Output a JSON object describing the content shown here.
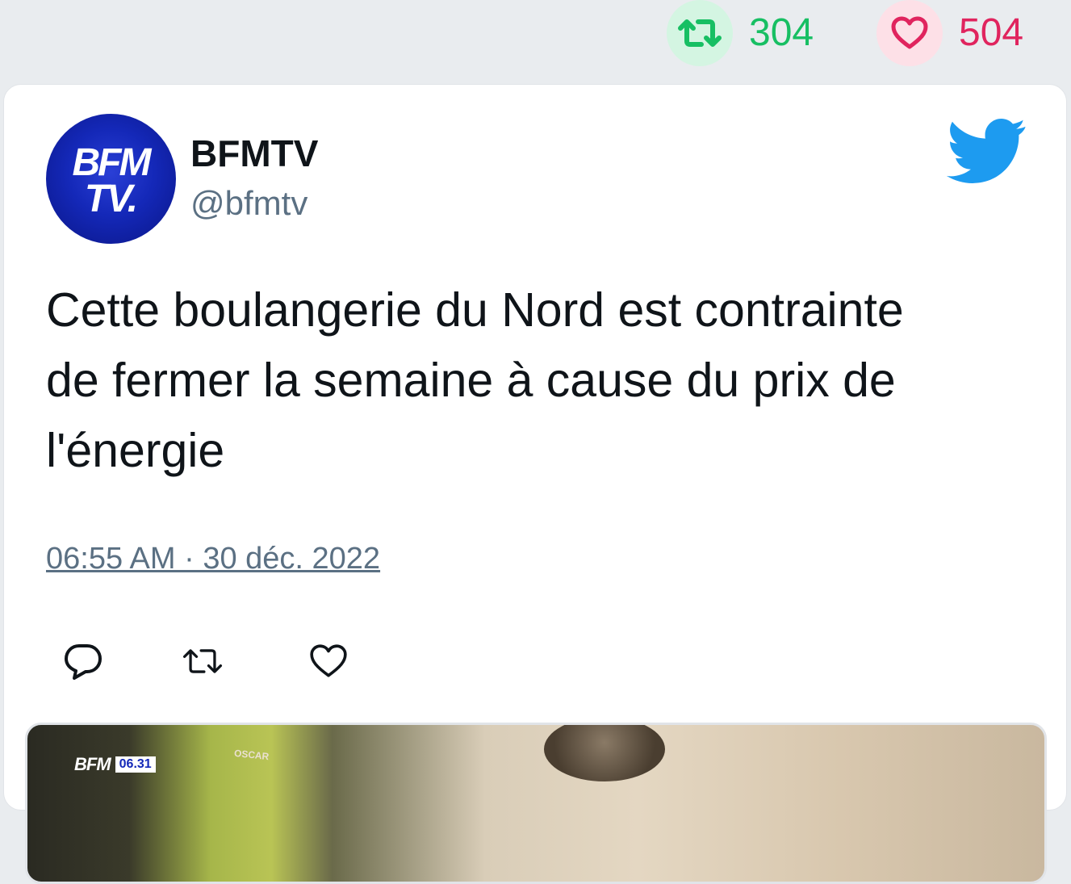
{
  "stats": {
    "retweet_count": "304",
    "like_count": "504"
  },
  "author": {
    "name": "BFMTV",
    "handle": "@bfmtv",
    "avatar_text_line1": "BFM",
    "avatar_text_line2": "TV."
  },
  "tweet": {
    "text_lines": [
      "Cette boulangerie du Nord est contrainte",
      "de fermer la semaine à cause du prix de",
      "l'énergie"
    ],
    "timestamp": "06:55 AM · 30 déc. 2022"
  },
  "media": {
    "logo_text": "BFM",
    "logo_time": "06.31",
    "shop_sign": "OSCAR"
  },
  "colors": {
    "retweet": "#17bf63",
    "like": "#e0245e",
    "twitter_blue": "#1d9bf0",
    "handle_gray": "#5b7083"
  },
  "icons": {
    "retweet": "retweet-icon",
    "like": "heart-icon",
    "reply": "reply-icon",
    "brand": "twitter-bird-icon"
  }
}
